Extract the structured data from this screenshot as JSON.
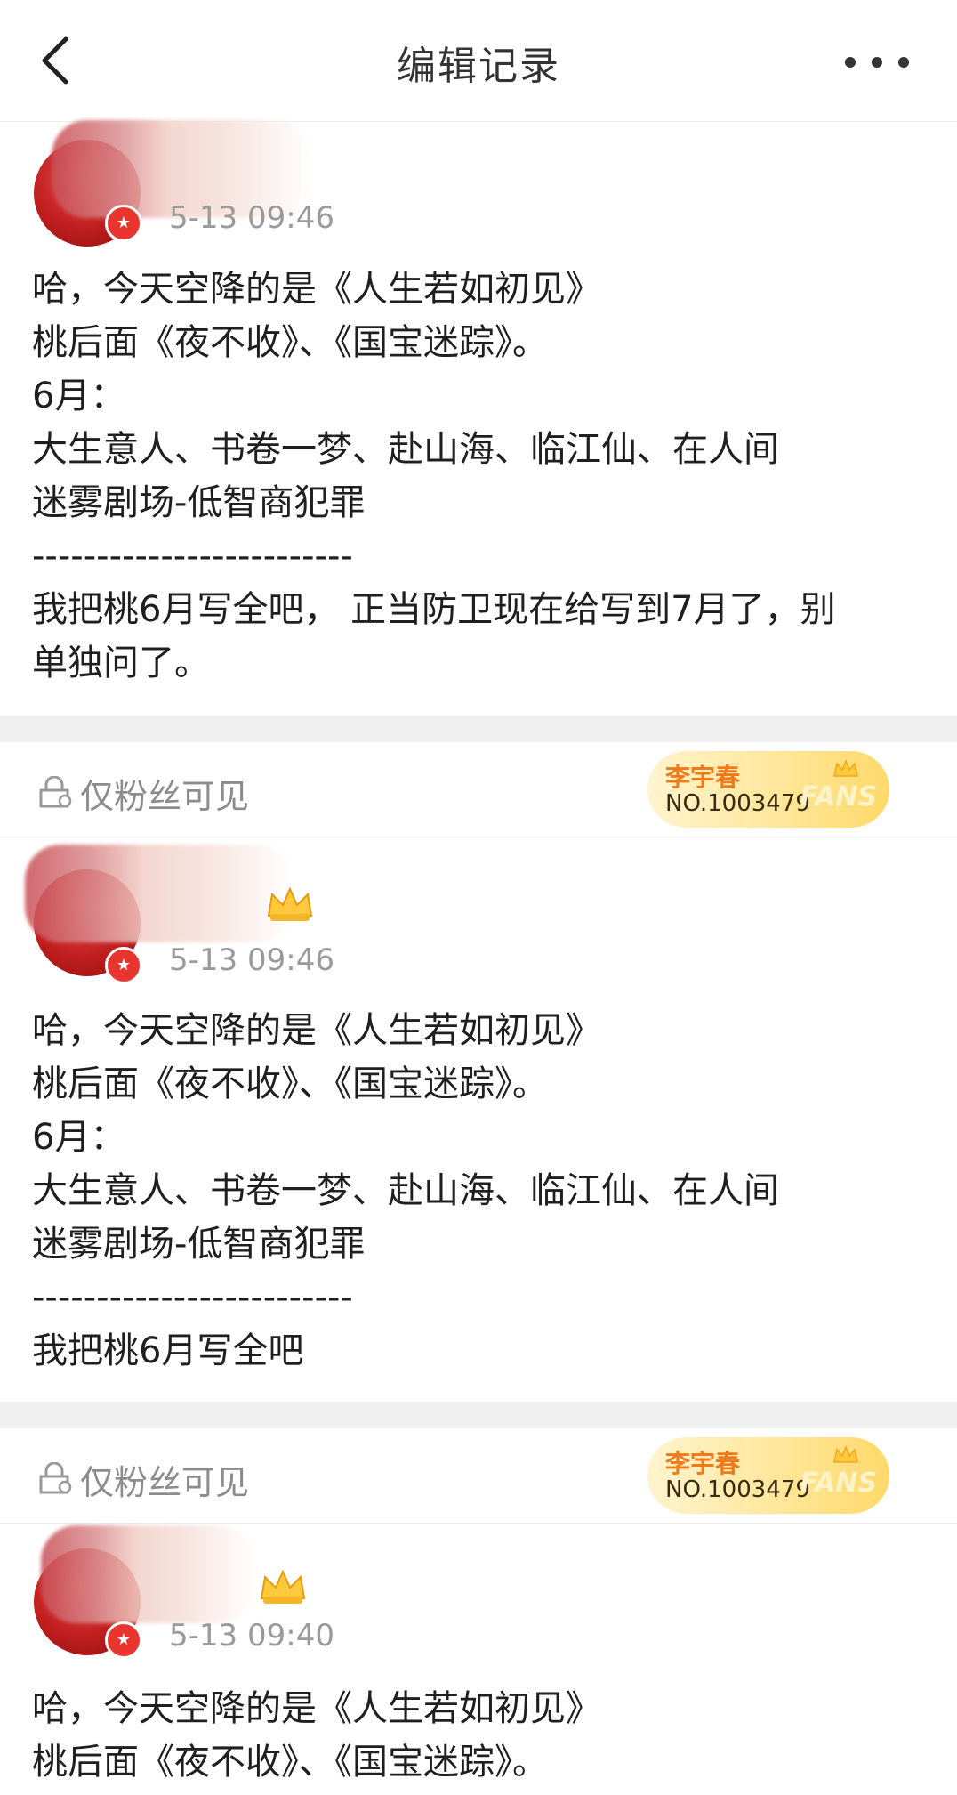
{
  "header": {
    "title": "编辑记录"
  },
  "posts": [
    {
      "timestamp": "5-13 09:46",
      "content": "哈，今天空降的是《人生若如初见》\n桃后面《夜不收》、《国宝迷踪》。\n6月：\n大生意人、书卷一梦、赴山海、临江仙、在人间\n迷雾剧场-低智商犯罪\n-------------------------\n我把桃6月写全吧， 正当防卫现在给写到7月了，别\n单独问了。"
    },
    {
      "timestamp": "5-13 09:46",
      "content": "哈，今天空降的是《人生若如初见》\n桃后面《夜不收》、《国宝迷踪》。\n6月：\n大生意人、书卷一梦、赴山海、临江仙、在人间\n迷雾剧场-低智商犯罪\n-------------------------\n我把桃6月写全吧"
    },
    {
      "timestamp": "5-13 09:40",
      "content": "哈，今天空降的是《人生若如初见》\n桃后面《夜不收》、《国宝迷踪》。"
    }
  ],
  "fans_only": {
    "label": "仅粉丝可见",
    "card_name": "李宇春",
    "card_number": "NO.1003479",
    "card_word": "FANS"
  },
  "icons": {
    "back": "chevron-left-icon",
    "more": "more-dots-icon",
    "lock": "lock-icon",
    "badge": "star-badge-icon",
    "crown": "crown-icon"
  },
  "colors": {
    "accent": "#e8362f",
    "fan_card_text": "#f07a1a",
    "secondary_text": "#9a9a9a"
  }
}
